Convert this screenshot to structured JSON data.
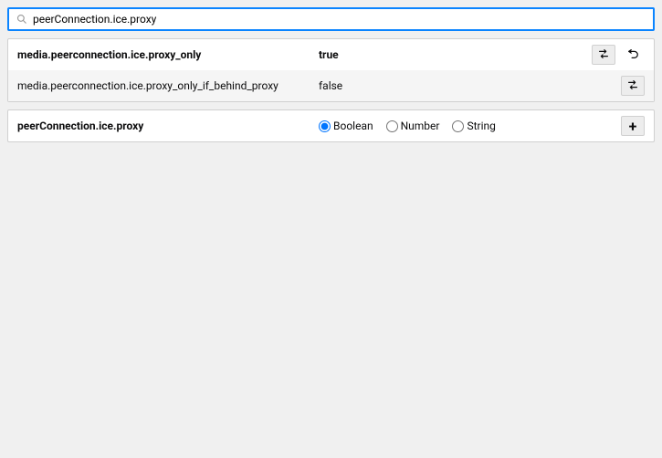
{
  "search": {
    "value": "peerConnection.ice.proxy",
    "placeholder": ""
  },
  "prefs": [
    {
      "name": "media.peerconnection.ice.proxy_only",
      "value": "true",
      "modified": true,
      "hasToggle": true,
      "hasReset": true
    },
    {
      "name": "media.peerconnection.ice.proxy_only_if_behind_proxy",
      "value": "false",
      "modified": false,
      "hasToggle": true,
      "hasReset": false
    }
  ],
  "newPref": {
    "name": "peerConnection.ice.proxy",
    "types": {
      "boolean": "Boolean",
      "number": "Number",
      "string": "String"
    },
    "selected": "boolean",
    "addLabel": "+"
  }
}
